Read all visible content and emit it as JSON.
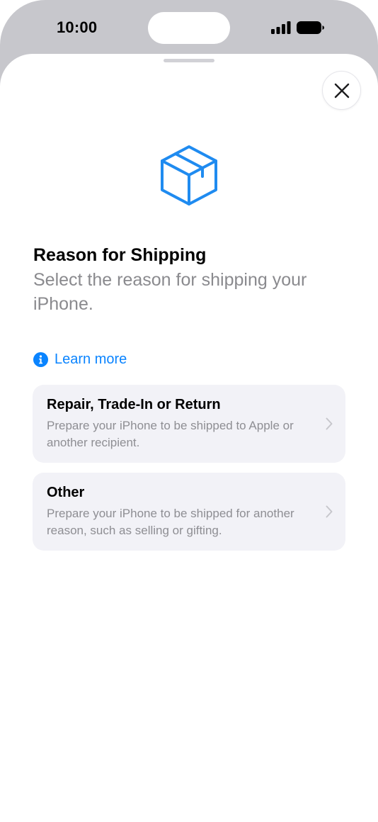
{
  "status_bar": {
    "time": "10:00",
    "icons": [
      "signal-icon",
      "battery-icon"
    ]
  },
  "sheet": {
    "close_icon": "close-icon",
    "hero_icon": "shipping-box-icon",
    "title": "Reason for Shipping",
    "subtitle": "Select the reason for shipping your iPhone.",
    "learn_more": {
      "icon": "info-icon",
      "label": "Learn more"
    },
    "options": [
      {
        "title": "Repair, Trade-In or Return",
        "description": "Prepare your iPhone to be shipped to Apple or another recipient."
      },
      {
        "title": "Other",
        "description": "Prepare your iPhone to be shipped for another reason, such as selling or gifting."
      }
    ]
  },
  "colors": {
    "accent": "#0a84ff",
    "card_background": "#f2f2f7",
    "secondary_text": "#8a8a8e"
  }
}
